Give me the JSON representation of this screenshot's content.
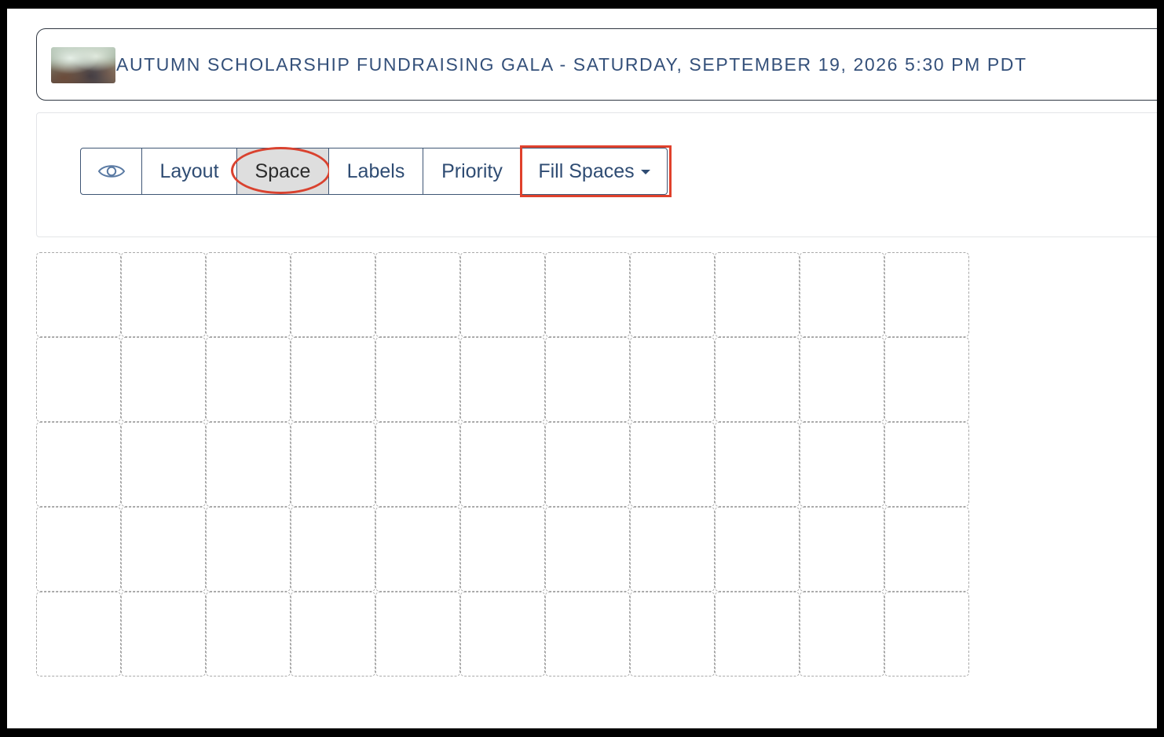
{
  "event": {
    "title": "AUTUMN SCHOLARSHIP FUNDRAISING GALA - SATURDAY, SEPTEMBER 19, 2026 5:30 PM PDT",
    "thumbnail": "event-photo"
  },
  "toolbar": {
    "view_icon": "eye-icon",
    "buttons": [
      {
        "label": "Layout"
      },
      {
        "label": "Space",
        "active": true
      },
      {
        "label": "Labels"
      },
      {
        "label": "Priority"
      }
    ],
    "fill_spaces": {
      "label": "Fill Spaces",
      "icon": "caret-down-icon"
    }
  },
  "grid": {
    "columns": 11,
    "rows": 5
  },
  "colors": {
    "accent": "#2f4c73",
    "active_bg": "#dedede",
    "highlight": "#e0412c"
  }
}
